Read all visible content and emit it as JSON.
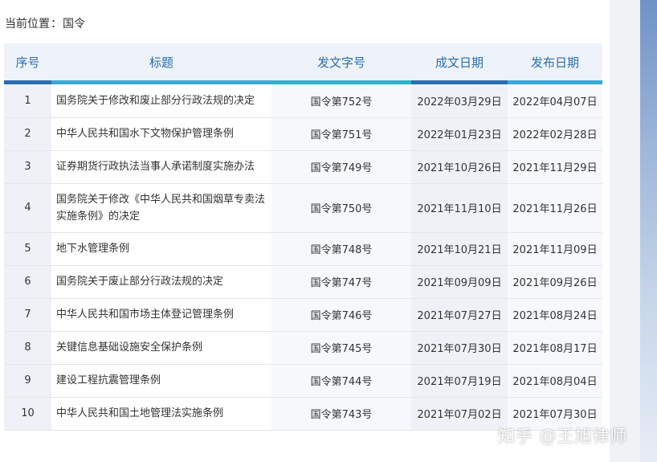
{
  "breadcrumb": {
    "label": "当前位置",
    "separator": "：",
    "current": "国令"
  },
  "table": {
    "headers": [
      "序号",
      "标题",
      "发文字号",
      "成文日期",
      "发布日期"
    ],
    "rows": [
      {
        "no": "1",
        "title": "国务院关于修改和废止部分行政法规的决定",
        "doc": "国令第752号",
        "written": "2022年03月29日",
        "published": "2022年04月07日"
      },
      {
        "no": "2",
        "title": "中华人民共和国水下文物保护管理条例",
        "doc": "国令第751号",
        "written": "2022年01月23日",
        "published": "2022年02月28日"
      },
      {
        "no": "3",
        "title": "证券期货行政执法当事人承诺制度实施办法",
        "doc": "国令第749号",
        "written": "2021年10月26日",
        "published": "2021年11月29日"
      },
      {
        "no": "4",
        "title": "国务院关于修改《中华人民共和国烟草专卖法实施条例》的决定",
        "doc": "国令第750号",
        "written": "2021年11月10日",
        "published": "2021年11月26日"
      },
      {
        "no": "5",
        "title": "地下水管理条例",
        "doc": "国令第748号",
        "written": "2021年10月21日",
        "published": "2021年11月09日"
      },
      {
        "no": "6",
        "title": "国务院关于废止部分行政法规的决定",
        "doc": "国令第747号",
        "written": "2021年09月09日",
        "published": "2021年09月26日"
      },
      {
        "no": "7",
        "title": "中华人民共和国市场主体登记管理条例",
        "doc": "国令第746号",
        "written": "2021年07月27日",
        "published": "2021年08月24日"
      },
      {
        "no": "8",
        "title": "关键信息基础设施安全保护条例",
        "doc": "国令第745号",
        "written": "2021年07月30日",
        "published": "2021年08月17日"
      },
      {
        "no": "9",
        "title": "建设工程抗震管理条例",
        "doc": "国令第744号",
        "written": "2021年07月19日",
        "published": "2021年08月04日"
      },
      {
        "no": "10",
        "title": "中华人民共和国土地管理法实施条例",
        "doc": "国令第743号",
        "written": "2021年07月02日",
        "published": "2021年07月30日"
      }
    ]
  },
  "watermark": "知乎 @王旭律师",
  "colors": {
    "accent": "#2a6db0",
    "accent_light": "#3aa9d6",
    "teal": "#2bb5c9"
  }
}
